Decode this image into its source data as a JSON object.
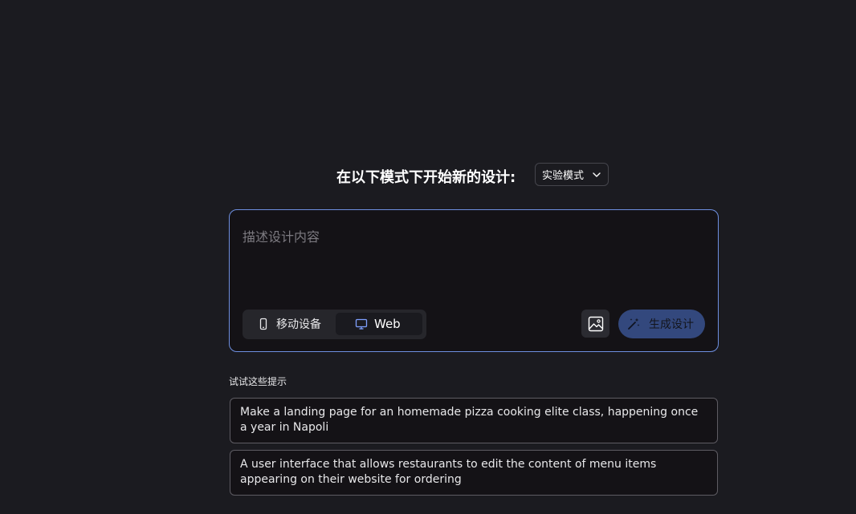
{
  "header": {
    "title": "在以下模式下开始新的设计:",
    "mode_selected": "实验模式"
  },
  "composer": {
    "placeholder": "描述设计内容",
    "device_options": [
      {
        "label": "移动设备",
        "icon": "phone-icon",
        "selected": false
      },
      {
        "label": "Web",
        "icon": "monitor-icon",
        "selected": true
      }
    ],
    "image_button_icon": "image-icon",
    "generate_label": "生成设计",
    "generate_icon": "magic-wand-icon"
  },
  "suggestions": {
    "heading": "试试这些提示",
    "items": [
      "Make a landing page for an homemade pizza cooking elite class, happening once a year in Napoli",
      "A user interface that allows restaurants to edit the content of menu items appearing on their website for ordering"
    ]
  },
  "colors": {
    "background": "#1b1b20",
    "accent_border": "#6e8fe0",
    "generate_button": "#33487d"
  }
}
